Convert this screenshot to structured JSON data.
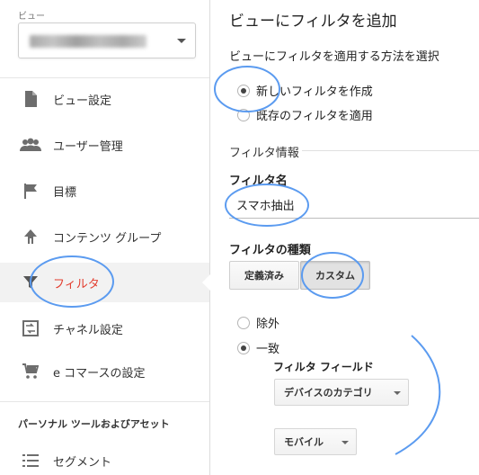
{
  "sidebar": {
    "view_label": "ビュー",
    "items": [
      {
        "label": "ビュー設定",
        "icon": "document-icon"
      },
      {
        "label": "ユーザー管理",
        "icon": "users-icon"
      },
      {
        "label": "目標",
        "icon": "flag-icon"
      },
      {
        "label": "コンテンツ グループ",
        "icon": "content-group-icon"
      },
      {
        "label": "フィルタ",
        "icon": "filter-icon",
        "active": true
      },
      {
        "label": "チャネル設定",
        "icon": "channel-icon"
      },
      {
        "label": "e コマースの設定",
        "icon": "cart-icon"
      }
    ],
    "section_heading": "パーソナル ツールおよびアセット",
    "segment_label": "セグメント"
  },
  "main": {
    "title": "ビューにフィルタを追加",
    "method_label": "ビューにフィルタを適用する方法を選択",
    "method_options": [
      {
        "label": "新しいフィルタを作成",
        "checked": true
      },
      {
        "label": "既存のフィルタを適用",
        "checked": false
      }
    ],
    "filter_info_label": "フィルタ情報",
    "filter_name_label": "フィルタ名",
    "filter_name_value": "スマホ抽出",
    "filter_type_label": "フィルタの種類",
    "type_buttons": [
      {
        "label": "定義済み",
        "selected": false
      },
      {
        "label": "カスタム",
        "selected": true
      }
    ],
    "custom_options": [
      {
        "label": "除外",
        "checked": false
      },
      {
        "label": "一致",
        "checked": true
      }
    ],
    "filter_field_label": "フィルタ フィールド",
    "filter_field_value": "デバイスのカテゴリ",
    "filter_pattern_value": "モバイル"
  },
  "colors": {
    "active_nav_text": "#e33d2e",
    "annotation_blue": "#5b9bf0"
  }
}
